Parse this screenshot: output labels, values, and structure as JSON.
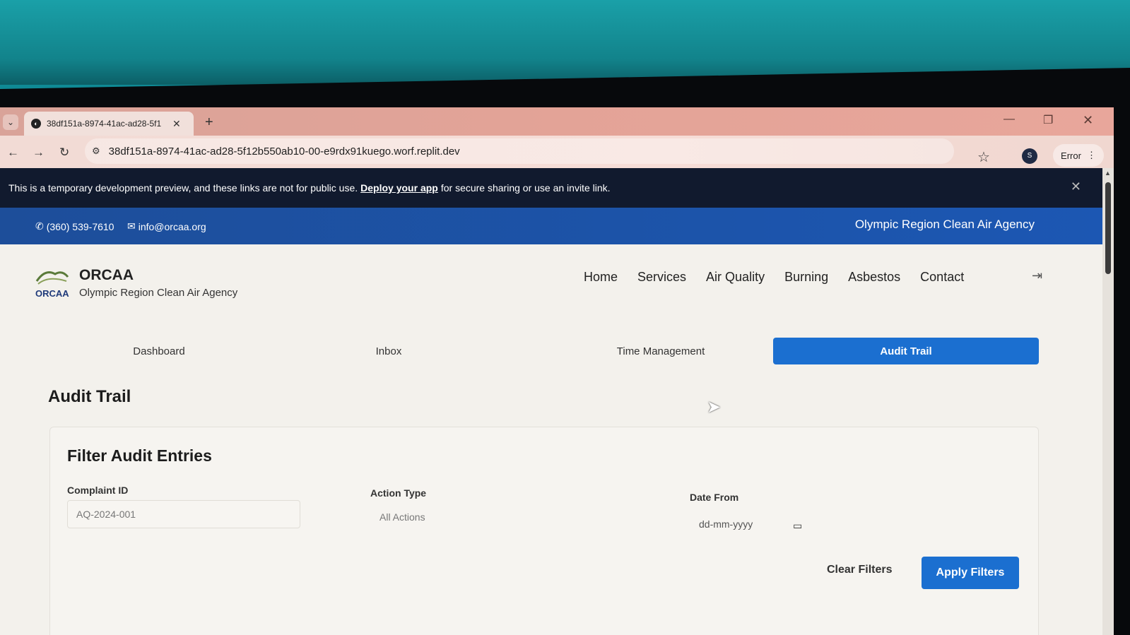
{
  "browser": {
    "tab_title": "38df151a-8974-41ac-ad28-5f1",
    "new_tab": "+",
    "url": "38df151a-8974-41ac-ad28-5f12b550ab10-00-e9rdx91kuego.worf.replit.dev",
    "profile_initial": "S",
    "error_label": "Error"
  },
  "preview_banner": {
    "text_before": "This is a temporary development preview, and these links are not for public use.",
    "link": "Deploy your app",
    "text_after": "for secure sharing or use an invite link."
  },
  "contact_bar": {
    "phone": "(360) 539-7610",
    "email": "info@orcaa.org",
    "agency": "Olympic Region Clean Air Agency"
  },
  "header": {
    "brand_name": "ORCAA",
    "brand_subtitle": "Olympic Region Clean Air Agency",
    "logo_text": "ORCAA",
    "nav": [
      "Home",
      "Services",
      "Air Quality",
      "Burning",
      "Asbestos",
      "Contact"
    ]
  },
  "subtabs": [
    {
      "label": "Dashboard",
      "active": false
    },
    {
      "label": "Inbox",
      "active": false
    },
    {
      "label": "Time Management",
      "active": false
    },
    {
      "label": "Audit Trail",
      "active": true
    }
  ],
  "page_title": "Audit Trail",
  "filters": {
    "title": "Filter Audit Entries",
    "complaint_id_label": "Complaint ID",
    "complaint_id_placeholder": "AQ-2024-001",
    "action_type_label": "Action Type",
    "action_type_value": "All Actions",
    "date_from_label": "Date From",
    "date_from_placeholder": "dd-mm-yyyy",
    "clear_label": "Clear Filters",
    "apply_label": "Apply Filters"
  },
  "colors": {
    "primary": "#1b6fd0",
    "contact_bar": "#1c57b3",
    "banner": "#111a2e"
  }
}
